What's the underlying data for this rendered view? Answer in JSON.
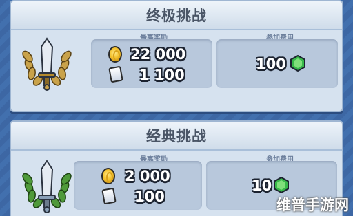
{
  "challenges": [
    {
      "title": "终极挑战",
      "reward_label": "最高奖励",
      "reward_gold": "22 000",
      "reward_cards": "1 100",
      "fee_label": "参加费用",
      "fee_amount": "100",
      "emblem": "gold-laurel-sword-icon"
    },
    {
      "title": "经典挑战",
      "reward_label": "最高奖励",
      "reward_gold": "2 000",
      "reward_cards": "100",
      "fee_label": "参加费用",
      "fee_amount": "10",
      "emblem": "green-laurel-sword-icon"
    }
  ],
  "watermark": "维普手游网",
  "colors": {
    "background": "#3f6aa8",
    "card": "#d6e2ef",
    "panel": "#b8c8dc",
    "gold_laurel": "#c9a24a",
    "green_laurel": "#4f9a3a",
    "gem": "#38b84a"
  }
}
